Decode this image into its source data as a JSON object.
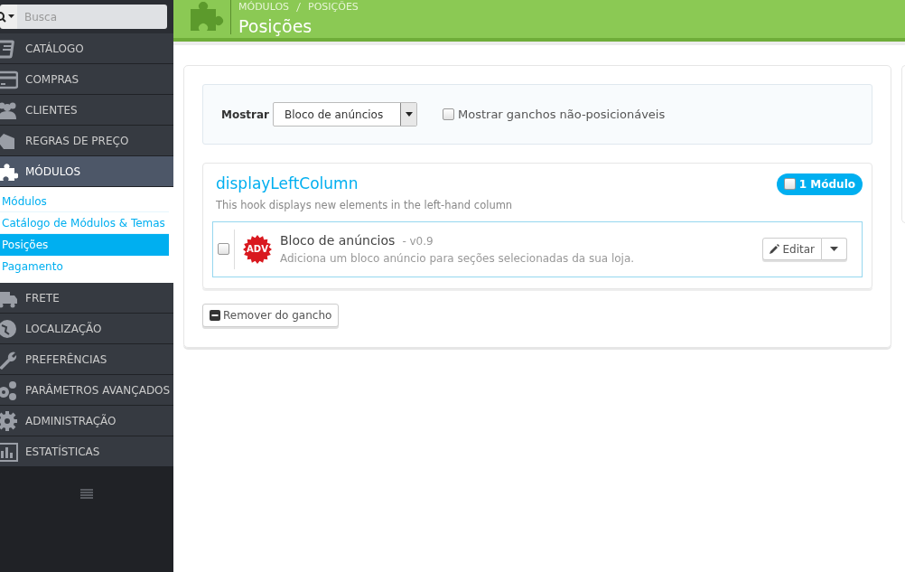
{
  "sidebar": {
    "search": {
      "placeholder": "Busca"
    },
    "items": [
      {
        "label": "CATÁLOGO",
        "expanded": false
      },
      {
        "label": "COMPRAS",
        "expanded": false
      },
      {
        "label": "CLIENTES",
        "expanded": false
      },
      {
        "label": "REGRAS DE PREÇO",
        "expanded": false
      },
      {
        "label": "MÓDULOS",
        "expanded": true,
        "children": [
          {
            "label": "Módulos",
            "selected": false
          },
          {
            "label": "Catálogo de Módulos & Temas",
            "selected": false
          },
          {
            "label": "Posições",
            "selected": true
          },
          {
            "label": "Pagamento",
            "selected": false
          }
        ]
      },
      {
        "label": "FRETE",
        "expanded": false
      },
      {
        "label": "LOCALIZAÇÃO",
        "expanded": false
      },
      {
        "label": "PREFERÊNCIAS",
        "expanded": false
      },
      {
        "label": "PARÂMETROS AVANÇADOS",
        "expanded": false
      },
      {
        "label": "ADMINISTRAÇÃO",
        "expanded": false
      },
      {
        "label": "ESTATÍSTICAS",
        "expanded": false
      }
    ]
  },
  "header": {
    "breadcrumb": [
      "MÓDULOS",
      "POSIÇÕES"
    ],
    "title": "Posições"
  },
  "filter": {
    "label": "Mostrar",
    "select_value": "Bloco de anúncios",
    "checkbox": {
      "label": "Mostrar ganchos não-posicionáveis",
      "checked": false
    }
  },
  "hook": {
    "name": "displayLeftColumn",
    "description": "This hook displays new elements in the left-hand column",
    "count_badge": {
      "label": "1 Módulo",
      "checked": false
    },
    "modules": [
      {
        "icon_text": "ADV",
        "name": "Bloco de anúncios",
        "version": "- v0.9",
        "description": "Adiciona um bloco anúncio para seções selecionadas da sua loja.",
        "checked": false,
        "button": "Editar"
      }
    ]
  },
  "remove_button": "Remover do gancho"
}
